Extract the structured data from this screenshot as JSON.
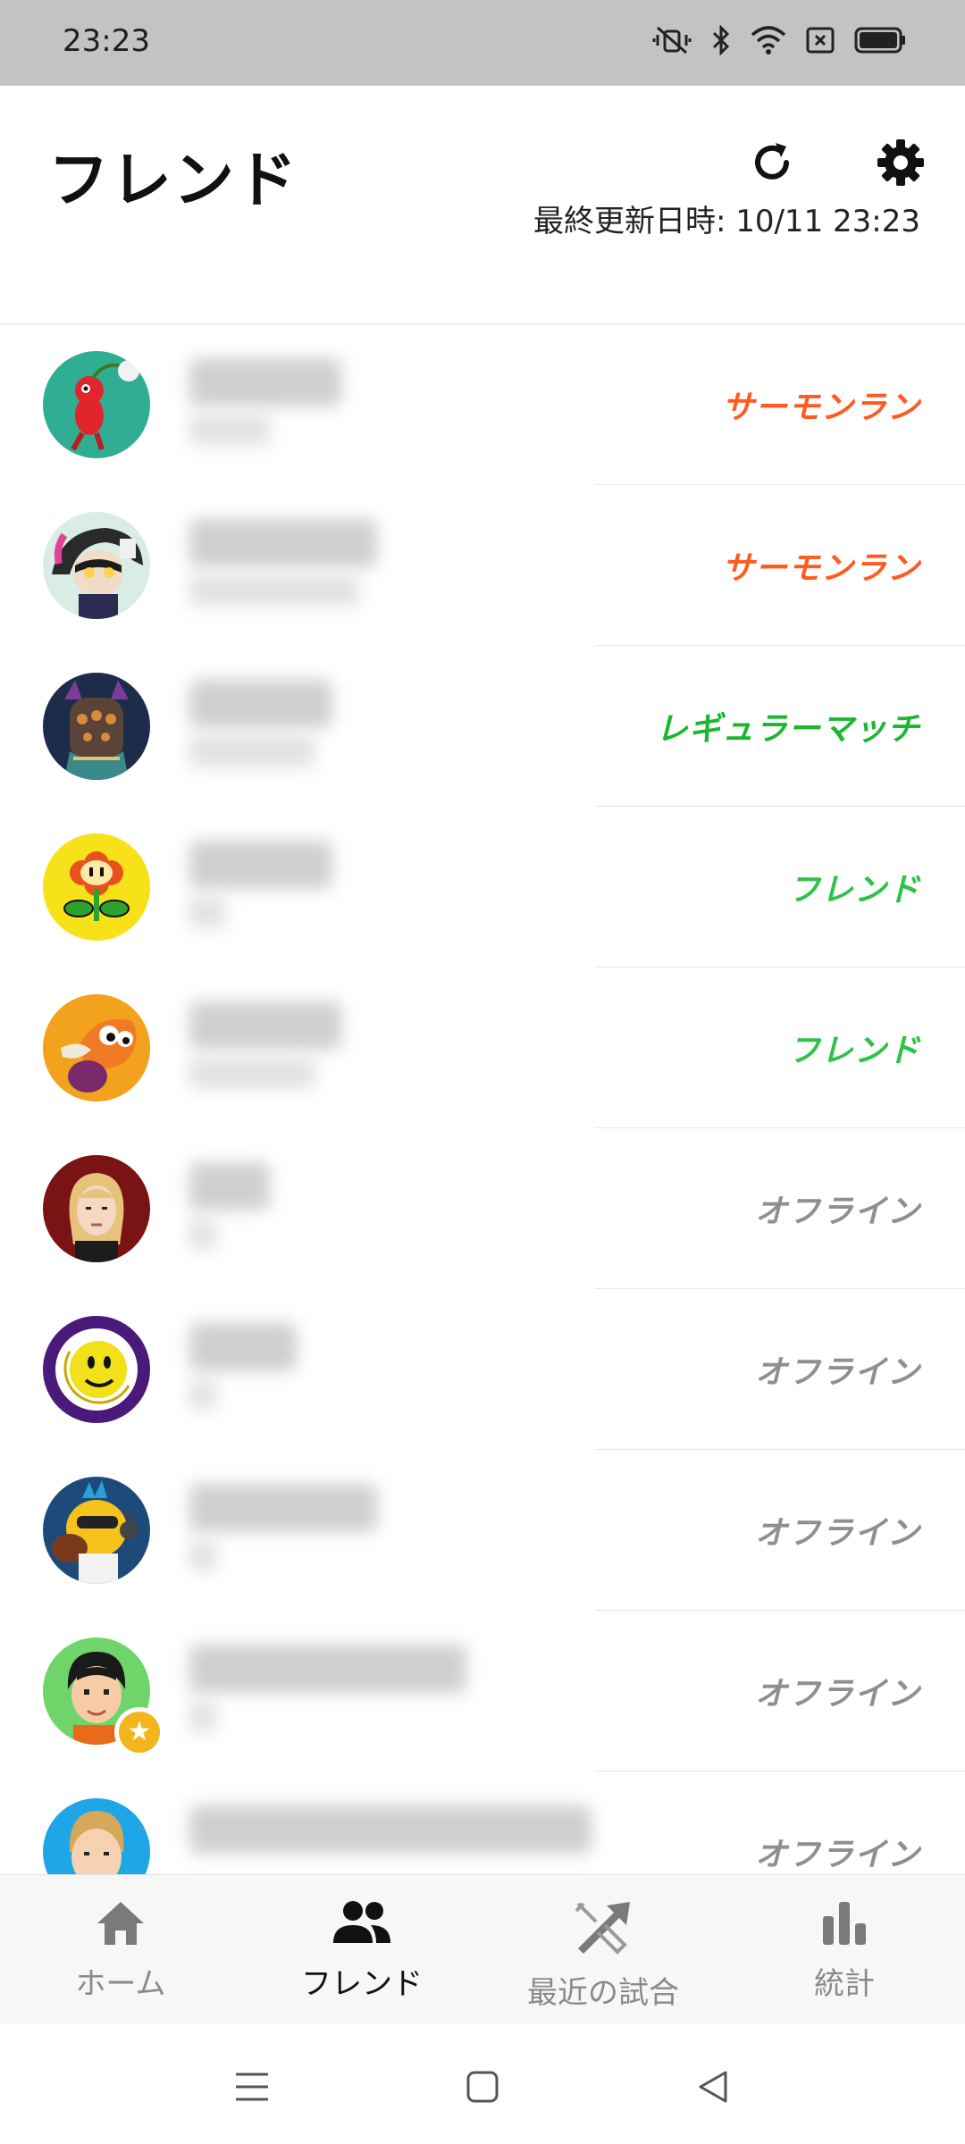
{
  "status_bar": {
    "time": "23:23",
    "icons": [
      "vibrate-off-icon",
      "bluetooth-icon",
      "wifi-icon",
      "sim-off-icon",
      "battery-icon"
    ]
  },
  "header": {
    "title": "フレンド",
    "refresh_icon": "refresh-icon",
    "settings_icon": "gear-icon",
    "last_updated": "最終更新日時: 10/11 23:23"
  },
  "friends": [
    {
      "status": "サーモンラン",
      "status_color": "#ff5a1f",
      "avatar": "pikmin"
    },
    {
      "status": "サーモンラン",
      "status_color": "#ff5a1f",
      "avatar": "callie"
    },
    {
      "status": "レギュラーマッチ",
      "status_color": "#19b82e",
      "avatar": "armored"
    },
    {
      "status": "フレンド",
      "status_color": "#2ec24a",
      "avatar": "fire-flower"
    },
    {
      "status": "フレンド",
      "status_color": "#2ec24a",
      "avatar": "octoling"
    },
    {
      "status": "オフライン",
      "status_color": "#8f8f8f",
      "avatar": "mii-blonde"
    },
    {
      "status": "オフライン",
      "status_color": "#8f8f8f",
      "avatar": "moon"
    },
    {
      "status": "オフライン",
      "status_color": "#8f8f8f",
      "avatar": "bird"
    },
    {
      "status": "オフライン",
      "status_color": "#8f8f8f",
      "avatar": "mii-boy"
    },
    {
      "status": "オフライン",
      "status_color": "#8f8f8f",
      "avatar": "mii-blue"
    }
  ],
  "tabs": [
    {
      "label": "ホーム",
      "icon": "home-icon",
      "active": false
    },
    {
      "label": "フレンド",
      "icon": "friends-icon",
      "active": true
    },
    {
      "label": "最近の試合",
      "icon": "battle-icon",
      "active": false
    },
    {
      "label": "統計",
      "icon": "stats-icon",
      "active": false
    }
  ],
  "nav_bar": {
    "icons": [
      "menu-icon",
      "home-square-icon",
      "back-icon"
    ]
  }
}
